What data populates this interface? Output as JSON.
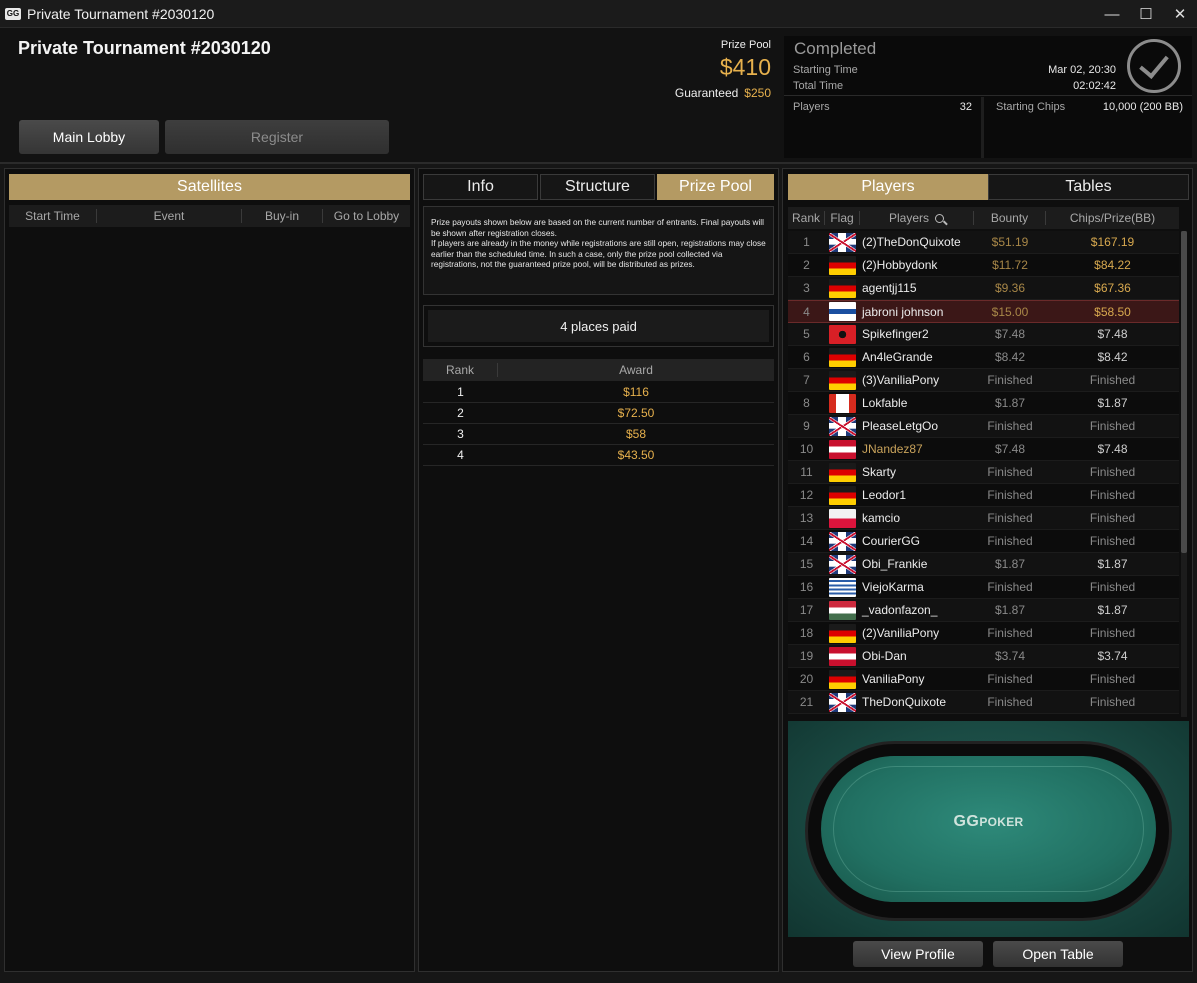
{
  "window": {
    "title": "Private Tournament #2030120",
    "app_logo": "GG",
    "controls": [
      "minimize-icon",
      "maximize-icon",
      "close-icon"
    ]
  },
  "header": {
    "tournament_title": "Private Tournament #2030120",
    "prize_pool_label": "Prize Pool",
    "prize_pool_amount": "$410",
    "guaranteed_label": "Guaranteed",
    "guaranteed_amount": "$250",
    "main_lobby_label": "Main Lobby",
    "register_label": "Register"
  },
  "status": {
    "state": "Completed",
    "starting_time_label": "Starting Time",
    "starting_time_value": "Mar 02, 20:30",
    "total_time_label": "Total Time",
    "total_time_value": "02:02:42",
    "players_label": "Players",
    "players_value": "32",
    "starting_chips_label": "Starting Chips",
    "starting_chips_value": "10,000 (200 BB)",
    "icon": "checkmark-circle-icon"
  },
  "satellites": {
    "title": "Satellites",
    "columns": [
      "Start Time",
      "Event",
      "Buy-in",
      "Go to Lobby"
    ]
  },
  "middle": {
    "tabs": [
      "Info",
      "Structure",
      "Prize Pool"
    ],
    "active_tab": "Prize Pool",
    "notice_lines": [
      "Prize payouts shown below are based on the current number of entrants. Final payouts will be shown after registration closes.",
      "If players are already in the money while registrations are still open, registrations may close earlier than the scheduled time. In such a case, only the prize pool collected via registrations, not the guaranteed prize pool, will be distributed as prizes."
    ],
    "places_paid": "4 places paid",
    "award_columns": [
      "Rank",
      "Award"
    ],
    "awards": [
      {
        "rank": "1",
        "award": "$116"
      },
      {
        "rank": "2",
        "award": "$72.50"
      },
      {
        "rank": "3",
        "award": "$58"
      },
      {
        "rank": "4",
        "award": "$43.50"
      }
    ]
  },
  "right": {
    "tabs": [
      "Players",
      "Tables"
    ],
    "active_tab": "Players",
    "columns": [
      "Rank",
      "Flag",
      "Players",
      "Bounty",
      "Chips/Prize(BB)"
    ],
    "players": [
      {
        "rank": "1",
        "flag": "uk",
        "name": "(2)TheDonQuixote",
        "bounty": "$51.19",
        "chips": "$167.19",
        "bounty_gold": true,
        "chips_gold": true,
        "name_gold": false,
        "highlight": false
      },
      {
        "rank": "2",
        "flag": "germany",
        "name": "(2)Hobbydonk",
        "bounty": "$11.72",
        "chips": "$84.22",
        "bounty_gold": true,
        "chips_gold": true,
        "name_gold": false,
        "highlight": false
      },
      {
        "rank": "3",
        "flag": "germany",
        "name": "agentjj115",
        "bounty": "$9.36",
        "chips": "$67.36",
        "bounty_gold": true,
        "chips_gold": true,
        "name_gold": false,
        "highlight": false
      },
      {
        "rank": "4",
        "flag": "finland",
        "name": "jabroni johnson",
        "bounty": "$15.00",
        "chips": "$58.50",
        "bounty_gold": true,
        "chips_gold": true,
        "name_gold": false,
        "highlight": true
      },
      {
        "rank": "5",
        "flag": "albania",
        "name": "Spikefinger2",
        "bounty": "$7.48",
        "chips": "$7.48",
        "bounty_gold": false,
        "chips_gold": false,
        "name_gold": false,
        "highlight": false
      },
      {
        "rank": "6",
        "flag": "germany",
        "name": "An4leGrande",
        "bounty": "$8.42",
        "chips": "$8.42",
        "bounty_gold": false,
        "chips_gold": false,
        "name_gold": false,
        "highlight": false
      },
      {
        "rank": "7",
        "flag": "germany",
        "name": "(3)VaniliaPony",
        "bounty": "Finished",
        "chips": "Finished",
        "bounty_gold": false,
        "chips_gold": false,
        "name_gold": false,
        "highlight": false
      },
      {
        "rank": "8",
        "flag": "canada",
        "name": "Lokfable",
        "bounty": "$1.87",
        "chips": "$1.87",
        "bounty_gold": false,
        "chips_gold": false,
        "name_gold": false,
        "highlight": false
      },
      {
        "rank": "9",
        "flag": "uk",
        "name": "PleaseLetgOo",
        "bounty": "Finished",
        "chips": "Finished",
        "bounty_gold": false,
        "chips_gold": false,
        "name_gold": false,
        "highlight": false
      },
      {
        "rank": "10",
        "flag": "austria",
        "name": "JNandez87",
        "bounty": "$7.48",
        "chips": "$7.48",
        "bounty_gold": false,
        "chips_gold": false,
        "name_gold": true,
        "highlight": false
      },
      {
        "rank": "11",
        "flag": "germany",
        "name": "Skarty",
        "bounty": "Finished",
        "chips": "Finished",
        "bounty_gold": false,
        "chips_gold": false,
        "name_gold": false,
        "highlight": false
      },
      {
        "rank": "12",
        "flag": "germany",
        "name": "Leodor1",
        "bounty": "Finished",
        "chips": "Finished",
        "bounty_gold": false,
        "chips_gold": false,
        "name_gold": false,
        "highlight": false
      },
      {
        "rank": "13",
        "flag": "poland",
        "name": "kamcio",
        "bounty": "Finished",
        "chips": "Finished",
        "bounty_gold": false,
        "chips_gold": false,
        "name_gold": false,
        "highlight": false
      },
      {
        "rank": "14",
        "flag": "uk",
        "name": "CourierGG",
        "bounty": "Finished",
        "chips": "Finished",
        "bounty_gold": false,
        "chips_gold": false,
        "name_gold": false,
        "highlight": false
      },
      {
        "rank": "15",
        "flag": "uk",
        "name": "Obi_Frankie",
        "bounty": "$1.87",
        "chips": "$1.87",
        "bounty_gold": false,
        "chips_gold": false,
        "name_gold": false,
        "highlight": false
      },
      {
        "rank": "16",
        "flag": "uruguay",
        "name": "ViejoKarma",
        "bounty": "Finished",
        "chips": "Finished",
        "bounty_gold": false,
        "chips_gold": false,
        "name_gold": false,
        "highlight": false
      },
      {
        "rank": "17",
        "flag": "hungary",
        "name": "_vadonfazon_",
        "bounty": "$1.87",
        "chips": "$1.87",
        "bounty_gold": false,
        "chips_gold": false,
        "name_gold": false,
        "highlight": false
      },
      {
        "rank": "18",
        "flag": "germany",
        "name": "(2)VaniliaPony",
        "bounty": "Finished",
        "chips": "Finished",
        "bounty_gold": false,
        "chips_gold": false,
        "name_gold": false,
        "highlight": false
      },
      {
        "rank": "19",
        "flag": "austria",
        "name": "Obi-Dan",
        "bounty": "$3.74",
        "chips": "$3.74",
        "bounty_gold": false,
        "chips_gold": false,
        "name_gold": false,
        "highlight": false
      },
      {
        "rank": "20",
        "flag": "germany",
        "name": "VaniliaPony",
        "bounty": "Finished",
        "chips": "Finished",
        "bounty_gold": false,
        "chips_gold": false,
        "name_gold": false,
        "highlight": false
      },
      {
        "rank": "21",
        "flag": "uk",
        "name": "TheDonQuixote",
        "bounty": "Finished",
        "chips": "Finished",
        "bounty_gold": false,
        "chips_gold": false,
        "name_gold": false,
        "highlight": false
      }
    ],
    "table_logo_brand": "GG",
    "table_logo_word": "POKER",
    "view_profile_label": "View Profile",
    "open_table_label": "Open Table"
  },
  "colors": {
    "gold": "#e7b14d",
    "tab_gold": "#b49a63",
    "highlight_row": "#3b1717"
  }
}
